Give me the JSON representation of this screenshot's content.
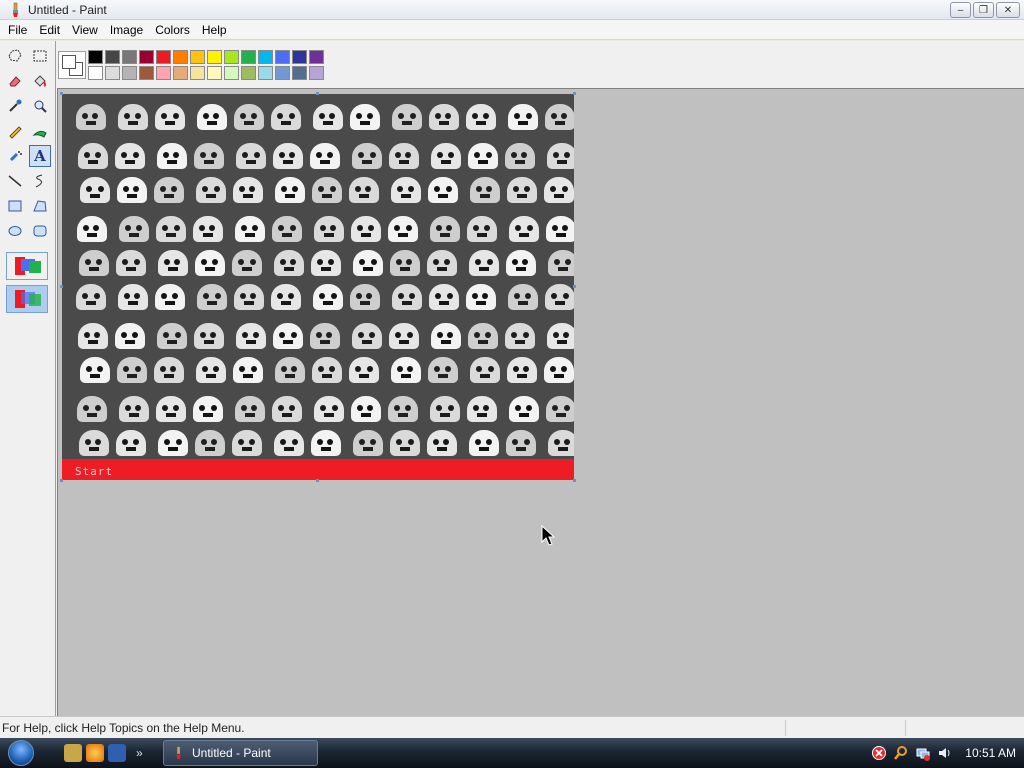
{
  "window": {
    "title": "Untitled - Paint",
    "controls": {
      "minimize": "–",
      "restore": "❐",
      "close": "✕"
    }
  },
  "menu": {
    "items": [
      {
        "label": "File"
      },
      {
        "label": "Edit"
      },
      {
        "label": "View"
      },
      {
        "label": "Image"
      },
      {
        "label": "Colors"
      },
      {
        "label": "Help"
      }
    ]
  },
  "toolbox": {
    "tools": [
      {
        "name": "free-form-select-icon"
      },
      {
        "name": "select-icon"
      },
      {
        "name": "eraser-icon"
      },
      {
        "name": "fill-icon"
      },
      {
        "name": "pick-color-icon"
      },
      {
        "name": "magnifier-icon"
      },
      {
        "name": "pencil-icon"
      },
      {
        "name": "brush-icon"
      },
      {
        "name": "airbrush-icon"
      },
      {
        "name": "text-icon",
        "glyph": "A",
        "active": true
      },
      {
        "name": "line-icon"
      },
      {
        "name": "curve-icon"
      },
      {
        "name": "rectangle-icon"
      },
      {
        "name": "polygon-icon"
      },
      {
        "name": "ellipse-icon"
      },
      {
        "name": "rounded-rectangle-icon"
      }
    ],
    "options": [
      {
        "name": "opaque-background-option"
      },
      {
        "name": "transparent-background-option",
        "active": true
      }
    ]
  },
  "palette": {
    "foreground": "#ffffff",
    "background": "#ffffff",
    "top_row": [
      "#000000",
      "#464646",
      "#787878",
      "#990030",
      "#ed1c24",
      "#ff7e00",
      "#ffc20e",
      "#fff200",
      "#a8e61d",
      "#22b14c",
      "#00b7ef",
      "#4d6df3",
      "#2f3699",
      "#6f3198"
    ],
    "bottom_row": [
      "#ffffff",
      "#dcdcdc",
      "#b4b4b4",
      "#9c5a3c",
      "#ffa3b1",
      "#e5aa7a",
      "#f5e49c",
      "#fff9bd",
      "#d3f9bc",
      "#9dbb61",
      "#99d9ea",
      "#709ad1",
      "#546d8e",
      "#b5a5d5"
    ]
  },
  "canvas": {
    "title_strip_color": "#ee1c24",
    "title_strip_text": "Start",
    "background_color": "#4a4a4a"
  },
  "status": {
    "help_text": "For Help, click Help Topics on the Help Menu."
  },
  "taskbar": {
    "task_button": "Untitled - Paint",
    "quick_launch_more": "»",
    "clock": "10:51 AM"
  }
}
